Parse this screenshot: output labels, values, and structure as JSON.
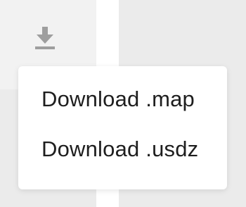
{
  "download_button": {
    "icon": "download-icon",
    "icon_color": "#9e9e9e"
  },
  "menu": {
    "items": [
      {
        "label": "Download .map"
      },
      {
        "label": "Download .usdz"
      }
    ]
  },
  "colors": {
    "menu_text": "#1e1e1e",
    "menu_background": "#ffffff",
    "panel_background": "#ebebeb"
  }
}
